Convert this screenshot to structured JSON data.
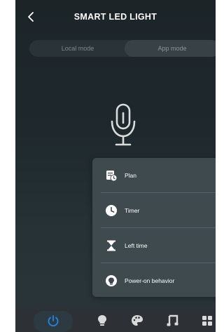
{
  "header": {
    "title": "SMART LED LIGHT",
    "back_icon": "chevron-left-icon"
  },
  "mode_toggle": {
    "local_label": "Local mode",
    "app_label": "App mode",
    "selected": "App mode"
  },
  "center": {
    "icon": "microphone-icon"
  },
  "menu": {
    "items": [
      {
        "label": "Plan",
        "icon": "plan-calendar-icon"
      },
      {
        "label": "Timer",
        "icon": "clock-icon"
      },
      {
        "label": "Left time",
        "icon": "hourglass-icon"
      },
      {
        "label": "Power-on behavior",
        "icon": "power-behavior-icon"
      }
    ]
  },
  "bottom_nav": {
    "items": [
      {
        "icon": "power-icon",
        "active": true
      },
      {
        "icon": "bulb-icon",
        "active": false
      },
      {
        "icon": "palette-icon",
        "active": false
      },
      {
        "icon": "music-icon",
        "active": false
      },
      {
        "icon": "grid-icon",
        "active": false
      }
    ]
  },
  "colors": {
    "background": "#1f292d",
    "menu_bg": "#3f4a4e",
    "accent_blue": "#1e88e5",
    "text": "#ffffff"
  }
}
